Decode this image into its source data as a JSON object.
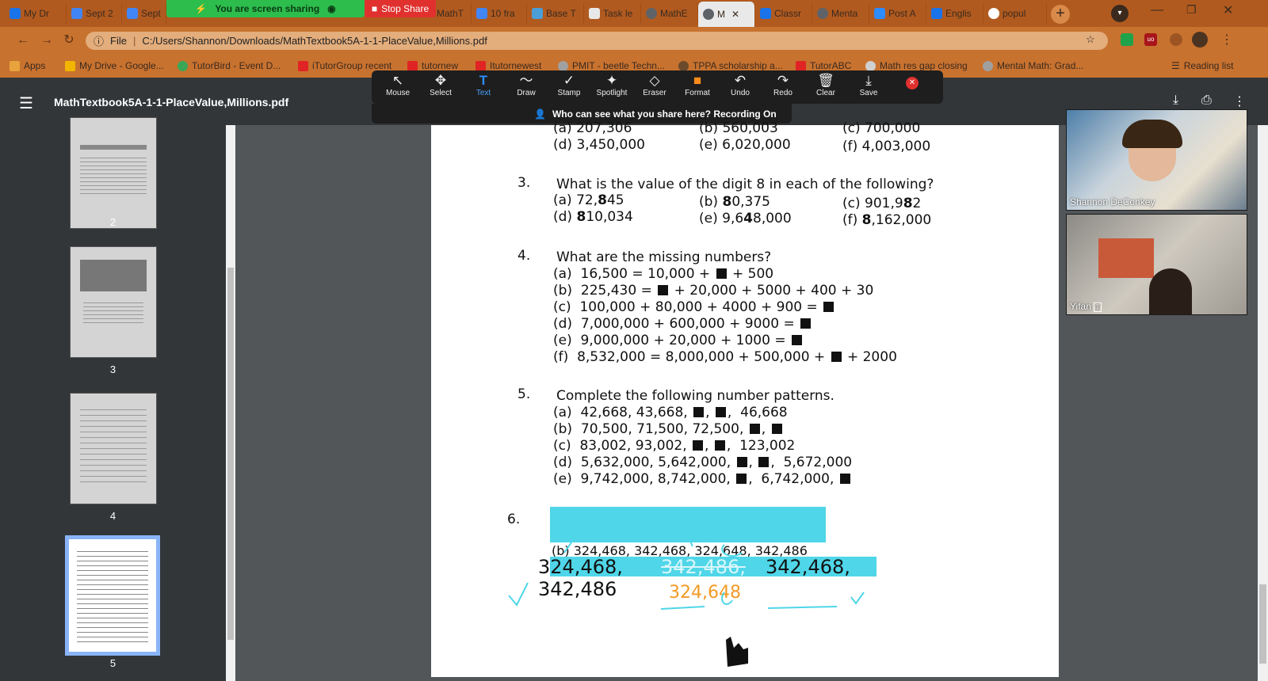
{
  "tabs": [
    {
      "label": "My Dr",
      "color": "#1a73e8"
    },
    {
      "label": "Sept 2",
      "color": "#4285f4"
    },
    {
      "label": "Sept",
      "color": "#4285f4"
    },
    {
      "label": "MathT",
      "color": "#4285f4"
    },
    {
      "label": "10 fra",
      "color": "#4285f4"
    },
    {
      "label": "Base T",
      "color": "#4a9fd9"
    },
    {
      "label": "Task le",
      "color": "#e8e8e8"
    },
    {
      "label": "MathE",
      "color": "#5f6368"
    },
    {
      "label": "M",
      "color": "#5f6368"
    },
    {
      "label": "Classr",
      "color": "#1a73e8"
    },
    {
      "label": "Menta",
      "color": "#5f6368"
    },
    {
      "label": "Post A",
      "color": "#2d8cff"
    },
    {
      "label": "Englis",
      "color": "#1a73e8"
    },
    {
      "label": "popul",
      "color": "#4285f4"
    }
  ],
  "screen_share": {
    "status": "You are screen sharing",
    "stop": "Stop Share"
  },
  "address": {
    "info": "File",
    "url": "C:/Users/Shannon/Downloads/MathTextbook5A-1-1-PlaceValue,Millions.pdf"
  },
  "bookmarks": [
    {
      "label": "Apps",
      "color": "#e8a33d"
    },
    {
      "label": "My Drive - Google...",
      "color": "#f2b600"
    },
    {
      "label": "TutorBird - Event D...",
      "color": "#3aa757"
    },
    {
      "label": "iTutorGroup recent",
      "color": "#e02424"
    },
    {
      "label": "tutornew",
      "color": "#e02424"
    },
    {
      "label": "Itutornewest",
      "color": "#e02424"
    },
    {
      "label": "PMIT - beetle Techn...",
      "color": "#a0a0a0"
    },
    {
      "label": "TPPA scholarship a...",
      "color": "#6a4a2a"
    },
    {
      "label": "TutorABC",
      "color": "#e02424"
    },
    {
      "label": "Math res gap closing",
      "color": "#d0d0d0"
    },
    {
      "label": "Mental Math: Grad...",
      "color": "#a0a0a0"
    }
  ],
  "reading_list": "Reading list",
  "pdf": {
    "title": "MathTextbook5A-1-1-PlaceValue,Millions.pdf"
  },
  "zoom_tools": [
    {
      "label": "Mouse",
      "glyph": "↖"
    },
    {
      "label": "Select",
      "glyph": "✥"
    },
    {
      "label": "Text",
      "glyph": "T"
    },
    {
      "label": "Draw",
      "glyph": "〜"
    },
    {
      "label": "Stamp",
      "glyph": "✓"
    },
    {
      "label": "Spotlight",
      "glyph": "✦"
    },
    {
      "label": "Eraser",
      "glyph": "◇"
    },
    {
      "label": "Format",
      "glyph": "■"
    },
    {
      "label": "Undo",
      "glyph": "↶"
    },
    {
      "label": "Redo",
      "glyph": "↷"
    },
    {
      "label": "Clear",
      "glyph": "🗑"
    },
    {
      "label": "Save",
      "glyph": "⤓"
    }
  ],
  "recording_text": "Who can see what you share here? Recording On",
  "thumb_pages": [
    "2",
    "3",
    "4",
    "5"
  ],
  "page": {
    "top_row1": [
      "(a)  207,306",
      "(b)  560,003",
      "(c)  700,000"
    ],
    "top_row2": [
      "(d)  3,450,000",
      "(e)  6,020,000",
      "(f)  4,003,000"
    ],
    "q3": {
      "num": "3.",
      "text": "What is the value of the digit 8 in each of the following?",
      "items": [
        "(a)  72,",
        "(b)  ",
        "(c)  901,9",
        "(d)  ",
        "(e)  9,6",
        "(f)  "
      ],
      "bold": [
        "8",
        "8",
        "8",
        "8",
        "4",
        "8"
      ],
      "rest": [
        "45",
        "0,375",
        "2",
        "10,034",
        "8,000",
        ",162,000"
      ]
    },
    "q4": {
      "num": "4.",
      "text": "What are the missing numbers?",
      "lines": [
        [
          "(a)",
          "16,500 = 10,000 + ",
          "+ 500"
        ],
        [
          "(b)",
          "225,430 = ",
          "+ 20,000 + 5000 + 400 + 30"
        ],
        [
          "(c)",
          "100,000 + 80,000 + 4000 + 900 = ",
          ""
        ],
        [
          "(d)",
          "7,000,000 + 600,000 + 9000 = ",
          ""
        ],
        [
          "(e)",
          "9,000,000 + 20,000 + 1000 = ",
          ""
        ],
        [
          "(f)",
          "8,532,000 = 8,000,000 + 500,000 + ",
          "+ 2000"
        ]
      ]
    },
    "q5": {
      "num": "5.",
      "text": "Complete the following number patterns.",
      "lines": [
        [
          "(a)",
          "42,668,  43,668,",
          "46,668"
        ],
        [
          "(b)",
          "70,500,  71,500,  72,500,",
          ""
        ],
        [
          "(c)",
          "83,002,  93,002,",
          "123,002"
        ],
        [
          "(d)",
          "5,632,000,  5,642,000,",
          "5,672,000"
        ],
        [
          "(e)",
          "9,742,000,  8,742,000,",
          "6,742,000,"
        ]
      ]
    },
    "q6": {
      "num": "6.",
      "b_line": "(b)   324,468,  342,468,  324,648,  342,486",
      "typed1": "324,468,",
      "typed2": "342,486",
      "typed3": "342,468,",
      "typed_orange": "324,648",
      "crossed": "342,486,"
    }
  },
  "participants": [
    {
      "name": "Shannon DeConkey"
    },
    {
      "name": "Yifan"
    }
  ]
}
